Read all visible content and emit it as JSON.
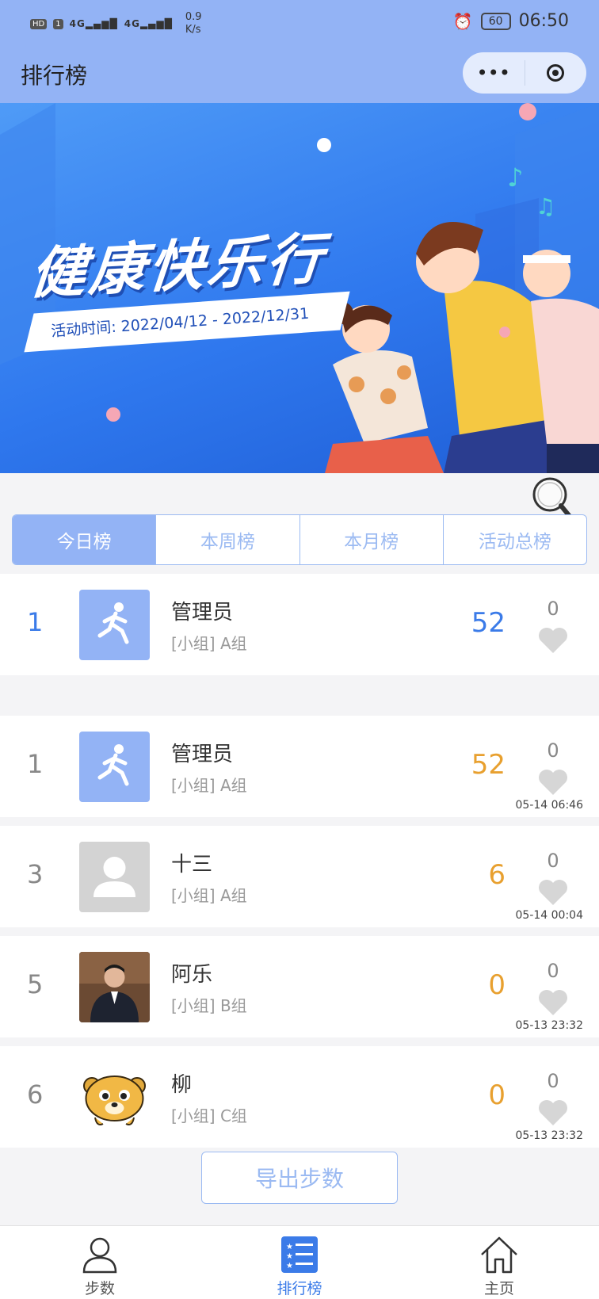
{
  "status_bar": {
    "hd": "HD",
    "sim": "1",
    "signal1": "4G",
    "signal2": "4G",
    "speed_value": "0.9",
    "speed_unit": "K/s",
    "battery": "60",
    "time": "06:50"
  },
  "header": {
    "title": "排行榜"
  },
  "banner": {
    "title": "健康快乐行",
    "date_range": "活动时间: 2022/04/12 - 2022/12/31"
  },
  "tabs": [
    {
      "label": "今日榜",
      "active": true
    },
    {
      "label": "本周榜",
      "active": false
    },
    {
      "label": "本月榜",
      "active": false
    },
    {
      "label": "活动总榜",
      "active": false
    }
  ],
  "my_rank": {
    "rank": "1",
    "name": "管理员",
    "group": "[小组] A组",
    "steps": "52",
    "likes": "0"
  },
  "rankings": [
    {
      "rank": "1",
      "name": "管理员",
      "group": "[小组] A组",
      "steps": "52",
      "likes": "0",
      "time": "05-14 06:46",
      "avatar": "runner-icon"
    },
    {
      "rank": "3",
      "name": "十三",
      "group": "[小组] A组",
      "steps": "6",
      "likes": "0",
      "time": "05-14 00:04",
      "avatar": "default-person-icon"
    },
    {
      "rank": "5",
      "name": "阿乐",
      "group": "[小组] B组",
      "steps": "0",
      "likes": "0",
      "time": "05-13 23:32",
      "avatar": "photo"
    },
    {
      "rank": "6",
      "name": "柳",
      "group": "[小组] C组",
      "steps": "0",
      "likes": "0",
      "time": "05-13 23:32",
      "avatar": "tiger-icon"
    }
  ],
  "export_button": "导出步数",
  "nav": [
    {
      "label": "步数",
      "icon": "person-icon"
    },
    {
      "label": "排行榜",
      "icon": "list-icon",
      "active": true
    },
    {
      "label": "主页",
      "icon": "home-icon"
    }
  ],
  "colors": {
    "accent": "#93b3f5",
    "blue_text": "#3b7be8",
    "orange_score": "#e8a02f"
  }
}
